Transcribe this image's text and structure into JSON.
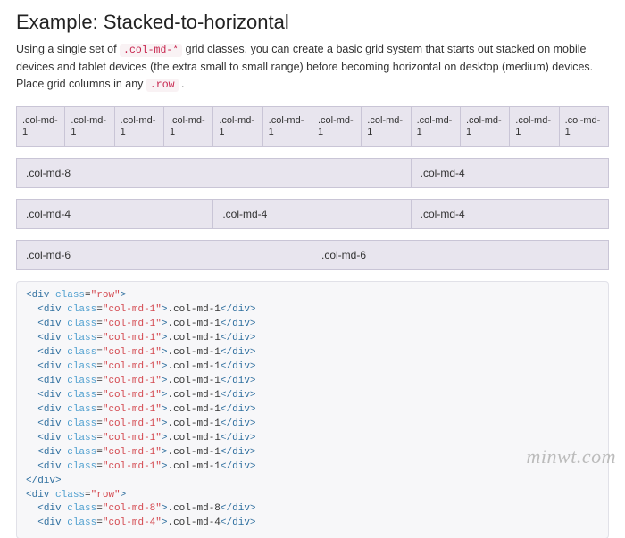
{
  "heading": "Example: Stacked-to-horizontal",
  "desc": {
    "part1": "Using a single set of ",
    "code1": ".col-md-*",
    "part2": " grid classes, you can create a basic grid system that starts out stacked on mobile devices and tablet devices (the extra small to small range) before becoming horizontal on desktop (medium) devices. Place grid columns in any ",
    "code2": ".row",
    "part3": " ."
  },
  "grid": {
    "md1": ".col-md-1",
    "md4": ".col-md-4",
    "md6": ".col-md-6",
    "md8": ".col-md-8"
  },
  "code": {
    "row_open": "<div class=\"row\">",
    "row_close": "</div>",
    "md1": "  <div class=\"col-md-1\">.col-md-1</div>",
    "md8": "  <div class=\"col-md-8\">.col-md-8</div>",
    "md4": "  <div class=\"col-md-4\">.col-md-4</div>",
    "tag_div_open": "div",
    "tag_div_close": "/div",
    "attr_class": "class",
    "val_row": "\"row\"",
    "val_md1": "\"col-md-1\"",
    "val_md8": "\"col-md-8\"",
    "val_md4": "\"col-md-4\"",
    "txt_md1": ".col-md-1",
    "txt_md8": ".col-md-8",
    "txt_md4": ".col-md-4"
  },
  "watermark": "minwt.com"
}
